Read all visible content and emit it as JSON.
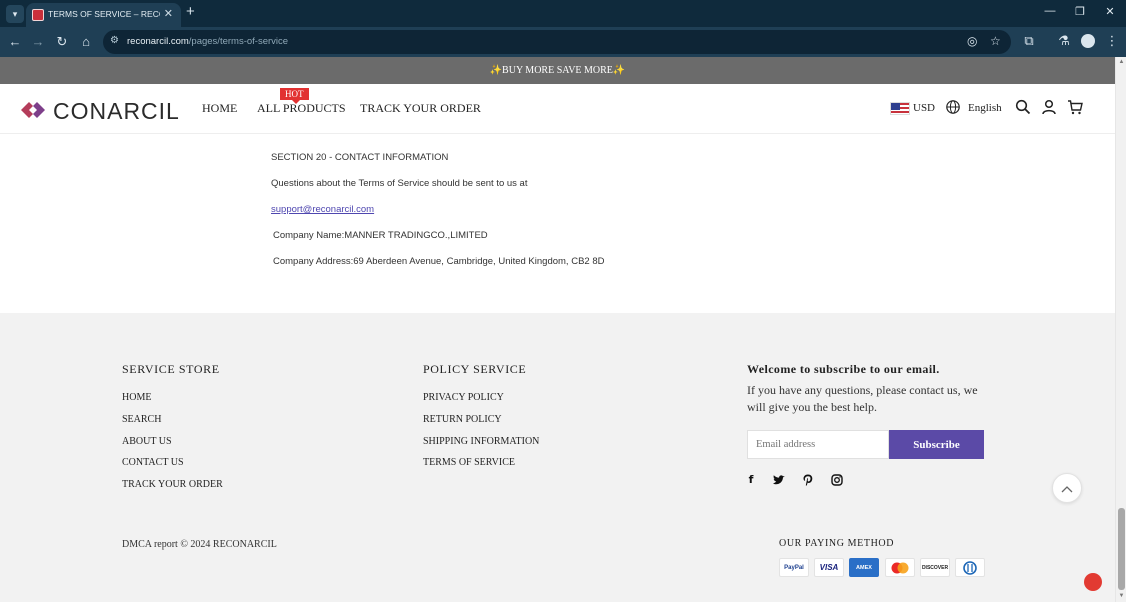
{
  "browser": {
    "tab_title": "TERMS OF SERVICE – RECONARCIL",
    "tab_close": "✕",
    "new_tab": "+",
    "menu_icon": "chevron-down",
    "window_controls": [
      "—",
      "❐",
      "✕"
    ],
    "url_domain": "reconarcil.com",
    "url_path": "/pages/terms-of-service"
  },
  "promo": {
    "text": "✨BUY MORE SAVE MORE✨"
  },
  "header": {
    "brand": "CONARCIL",
    "nav": [
      {
        "label": "HOME"
      },
      {
        "label": "ALL PRODUCTS",
        "badge": "HOT"
      },
      {
        "label": "TRACK YOUR ORDER"
      }
    ],
    "currency": "USD",
    "language": "English",
    "icons": [
      "search-icon",
      "user-icon",
      "cart-icon"
    ]
  },
  "content": {
    "section_title": "SECTION 20 - CONTACT INFORMATION",
    "question": "Questions about the Terms of Service should be sent to us at",
    "email": "support@reconarcil.com",
    "company_name": "Company Name:MANNER TRADINGCO.,LIMITED",
    "company_address": "Company Address:69 Aberdeen Avenue, Cambridge, United Kingdom, CB2 8D"
  },
  "footer": {
    "service_store": {
      "title": "SERVICE STORE",
      "links": [
        "HOME",
        "SEARCH",
        "ABOUT US",
        "CONTACT US",
        "TRACK YOUR ORDER"
      ]
    },
    "policy_service": {
      "title": "POLICY SERVICE",
      "links": [
        "PRIVACY POLICY",
        "RETURN POLICY",
        "SHIPPING INFORMATION",
        "TERMS OF SERVICE"
      ]
    },
    "subscribe": {
      "title": "Welcome to subscribe to our email.",
      "text": "If you have any questions, please contact us, we will give you the best help.",
      "placeholder": "Email address",
      "button": "Subscribe"
    },
    "social": [
      "facebook-icon",
      "twitter-icon",
      "pinterest-icon",
      "instagram-icon"
    ],
    "copyright": "DMCA report © 2024 RECONARCIL",
    "paying_title": "OUR PAYING METHOD",
    "payments": [
      "PayPal",
      "VISA",
      "AMEX",
      "Mastercard",
      "DISCOVER",
      "Diners"
    ]
  },
  "colors": {
    "promo_bg": "#6b6b6b",
    "accent": "#5b4aa7",
    "hot_badge": "#e23232",
    "footer_bg": "#f2f2f2",
    "link": "#4f47b0"
  }
}
